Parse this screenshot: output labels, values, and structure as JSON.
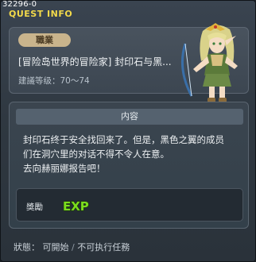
{
  "quest_id": "32296-0",
  "title": "QUEST INFO",
  "job_badge": "職業",
  "quest_name": "[冒险岛世界的冒险家] 封印石与黑...",
  "level_range": "建議等级：70～74",
  "content": {
    "header": "内容",
    "lines": [
      "封印石终于安全找回来了。但是，黑色之翼的成员",
      "们在洞穴里的对话不得不令人在意。",
      "去向赫丽娜报告吧！"
    ]
  },
  "reward": {
    "label": "獎勵",
    "icon": "exp-icon",
    "icon_text": "EXP"
  },
  "status": {
    "label": "狀態：",
    "startable": "可開始",
    "separator": "/",
    "not_executable": "不可执行任務"
  },
  "colors": {
    "title": "#f2d94a",
    "job_badge_bg": "#c9b48c",
    "exp_green": "#7bdc1e"
  }
}
